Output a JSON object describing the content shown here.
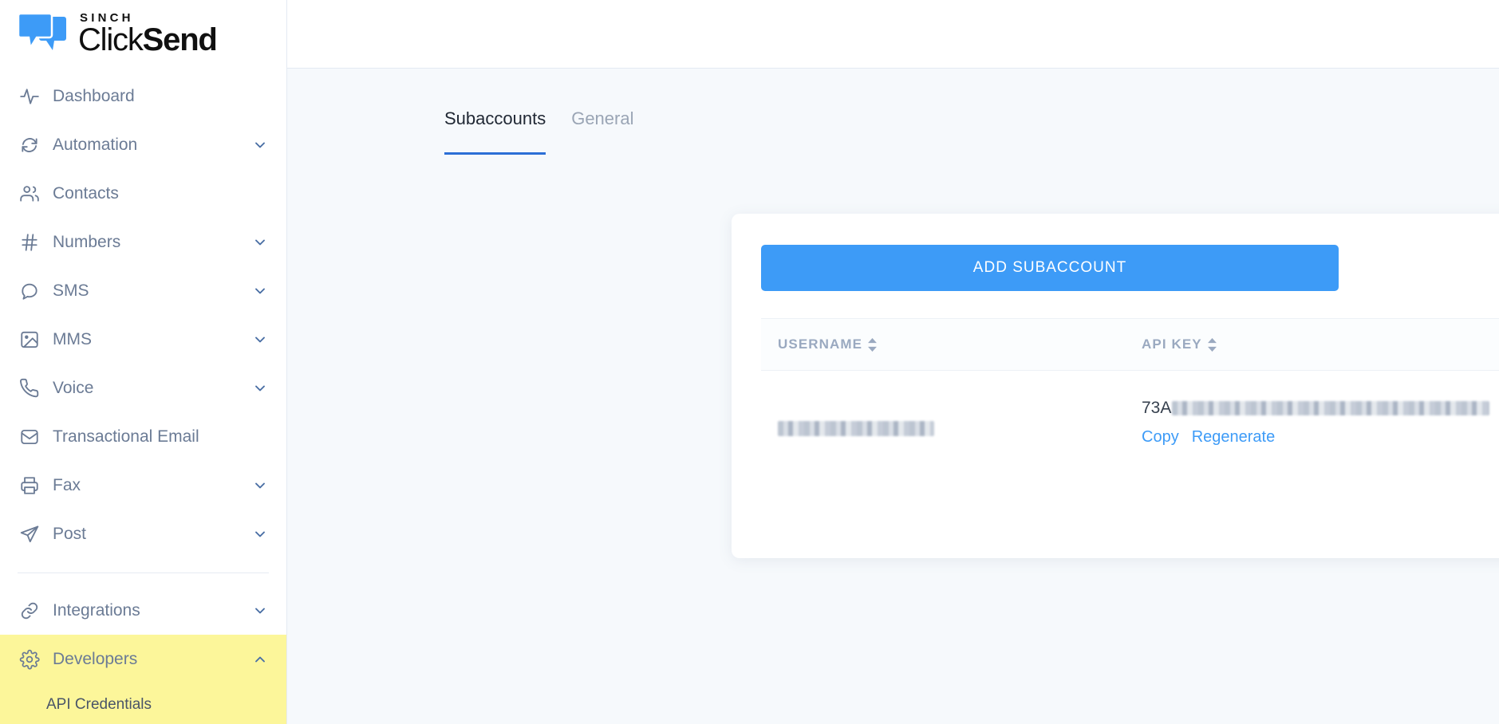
{
  "brand": {
    "logo_top": "SINCH",
    "logo_main_light": "Click",
    "logo_main_bold": "Send",
    "accent_blue": "#3d9bf7",
    "logo_blue": "#3d9bf7",
    "highlight_yellow": "#fcf69a",
    "tab_underline": "#2c6fd6"
  },
  "sidebar": {
    "items": [
      {
        "label": "Dashboard",
        "icon": "activity-icon",
        "expandable": false,
        "chevron": ""
      },
      {
        "label": "Automation",
        "icon": "refresh-icon",
        "expandable": true,
        "chevron": "down"
      },
      {
        "label": "Contacts",
        "icon": "users-icon",
        "expandable": false,
        "chevron": ""
      },
      {
        "label": "Numbers",
        "icon": "hash-icon",
        "expandable": true,
        "chevron": "down"
      },
      {
        "label": "SMS",
        "icon": "message-icon",
        "expandable": true,
        "chevron": "down"
      },
      {
        "label": "MMS",
        "icon": "image-icon",
        "expandable": true,
        "chevron": "down"
      },
      {
        "label": "Voice",
        "icon": "phone-icon",
        "expandable": true,
        "chevron": "down"
      },
      {
        "label": "Transactional Email",
        "icon": "inbox-icon",
        "expandable": false,
        "chevron": ""
      },
      {
        "label": "Fax",
        "icon": "printer-icon",
        "expandable": true,
        "chevron": "down"
      },
      {
        "label": "Post",
        "icon": "send-icon",
        "expandable": true,
        "chevron": "down"
      }
    ],
    "items_after_divider": [
      {
        "label": "Integrations",
        "icon": "link-icon",
        "expandable": true,
        "chevron": "down",
        "highlighted": false
      },
      {
        "label": "Developers",
        "icon": "gear-icon",
        "expandable": true,
        "chevron": "up",
        "highlighted": true
      }
    ],
    "sub_items": [
      {
        "label": "API Credentials",
        "parent": "Developers",
        "highlighted": true
      }
    ]
  },
  "main": {
    "tabs": [
      {
        "label": "Subaccounts",
        "active": true
      },
      {
        "label": "General",
        "active": false
      }
    ],
    "add_subaccount_label": "ADD SUBACCOUNT",
    "table": {
      "columns": [
        {
          "label": "USERNAME",
          "sortable": true
        },
        {
          "label": "API KEY",
          "sortable": true
        }
      ],
      "rows": [
        {
          "username": "",
          "username_redacted": true,
          "api_key_prefix": "73A",
          "api_key_redacted": true,
          "actions": [
            {
              "label": "Copy"
            },
            {
              "label": "Regenerate"
            }
          ]
        }
      ]
    }
  }
}
